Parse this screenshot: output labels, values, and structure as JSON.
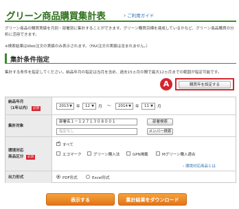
{
  "header": {
    "title": "グリーン商品購買集計表",
    "guide_link": "ご利用ガイド"
  },
  "intro": {
    "text": "グリーン商品の購買実績を月別・部署別に集計することができます。グリーン購買目標を達成しているかなど、グリーン商品購買の分析に活用できます。",
    "note": "※検索結果はWeb注文の実績のみ表示されます。（FAX注文の実績は含まれません。）"
  },
  "section": {
    "title": "集計条件指定",
    "instruction": "集計する条件を指定してください。納品年月の指定は当月を含め、過去15ヵ月の間で最大12ヵ月までの範囲が指定可能です。"
  },
  "callout": {
    "marker": "A",
    "period_button": "購買年を設定する"
  },
  "form": {
    "period": {
      "label": "納品年月",
      "sublabel": "（1年以内）",
      "required": "必須",
      "from_year": "2013",
      "from_month": "12",
      "to_year": "2014",
      "to_month": "11",
      "year_unit": "年",
      "month_unit": "月",
      "separator": "～"
    },
    "target": {
      "label": "集計対象",
      "dept_value": "部署名１－１２７１３０８００１",
      "dept_button": "部署検索",
      "member_placeholder": "指定なし",
      "member_button": "メンバー検索"
    },
    "category": {
      "label1": "環境対応",
      "label2": "商品区分",
      "required": "必須",
      "all": "すべて",
      "options": [
        "エコマーク",
        "グリーン購入法",
        "GPN掲載",
        "Mグリーン購入適合"
      ],
      "help_link": "環境対応商品とは"
    },
    "output": {
      "label": "出力形式",
      "options": [
        "PDF形式",
        "Excel形式"
      ]
    }
  },
  "actions": {
    "display": "表示する",
    "download": "集計結果をダウンロード"
  }
}
